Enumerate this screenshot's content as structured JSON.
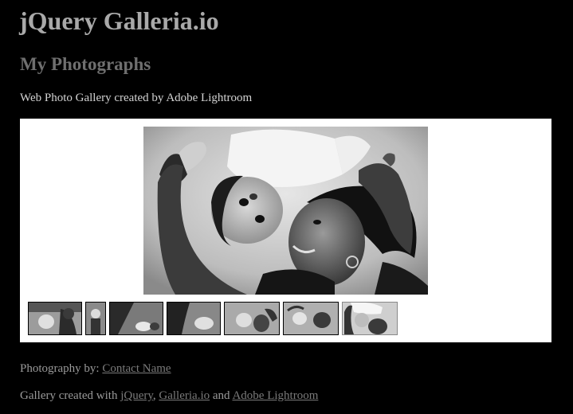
{
  "header": {
    "site_title": "jQuery Galleria.io",
    "gallery_title": "My Photographs",
    "gallery_description": "Web Photo Gallery created by Adobe Lightroom"
  },
  "gallery": {
    "main_image_alt": "",
    "thumbnail_count": 7
  },
  "footer": {
    "credit_prefix": "Photography by: ",
    "credit_link": "Contact Name",
    "made_prefix": "Gallery created with ",
    "link_jquery": "jQuery",
    "sep1": ", ",
    "link_galleria": "Galleria.io",
    "sep2": " and ",
    "link_lightroom": "Adobe Lightroom"
  },
  "colors": {
    "background": "#000000",
    "stage": "#ffffff",
    "site_title": "#a9a9a9",
    "gallery_title": "#6f6f6f",
    "link": "#7a7a7a"
  }
}
